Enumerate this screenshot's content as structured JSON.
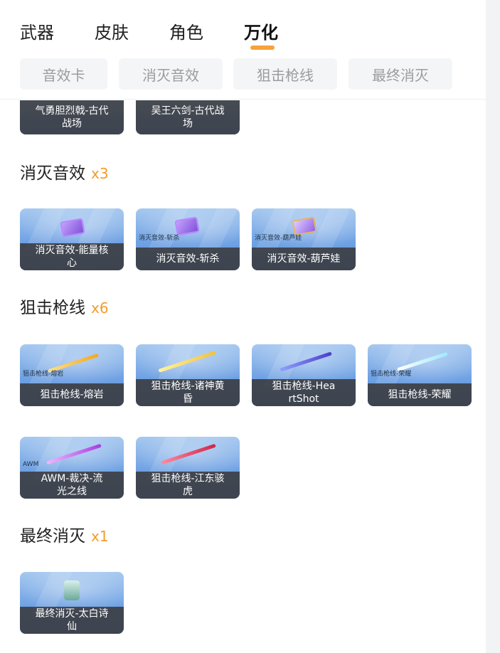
{
  "tabs": [
    "武器",
    "皮肤",
    "角色",
    "万化"
  ],
  "active_tab_index": 3,
  "filters": [
    "音效卡",
    "消灭音效",
    "狙击枪线",
    "最终消灭"
  ],
  "top_partial_cards": [
    {
      "line1": "气勇胆烈戟-古代",
      "line2": "战场"
    },
    {
      "line1": "吴王六剑-古代战",
      "line2": "场"
    }
  ],
  "sections": [
    {
      "title": "消灭音效",
      "count": "x3",
      "cards": [
        {
          "line1": "消灭音效-能量核",
          "line2": "心",
          "inner_label": "",
          "icon": "purple-card-icon"
        },
        {
          "line1": "消灭音效-斩杀",
          "line2": "",
          "inner_label": "消灭音效-斩杀",
          "icon": "purple-card-icon"
        },
        {
          "line1": "消灭音效-葫芦娃",
          "line2": "",
          "inner_label": "消灭音效-葫芦娃",
          "icon": "gold-card-icon"
        }
      ]
    },
    {
      "title": "狙击枪线",
      "count": "x6",
      "cards": [
        {
          "line1": "狙击枪线-熔岩",
          "line2": "",
          "inner_label": "狙击枪线-熔岩",
          "icon": "laser-icon",
          "color": "#f0c04a"
        },
        {
          "line1": "狙击枪线-诸神黄",
          "line2": "昏",
          "inner_label": "",
          "icon": "laser-icon",
          "color": "#f2c23c"
        },
        {
          "line1": "狙击枪线-Hea",
          "line2": "rtShot",
          "inner_label": "",
          "icon": "laser-icon",
          "color": "#5b4fd8"
        },
        {
          "line1": "狙击枪线-荣耀",
          "line2": "",
          "inner_label": "狙击枪线-荣耀",
          "icon": "laser-icon",
          "color": "#bff6ff"
        },
        {
          "line1": "AWM-裁决-流",
          "line2": "光之线",
          "inner_label": "AWM",
          "icon": "laser-icon",
          "color": "#c14ef0"
        },
        {
          "line1": "狙击枪线-江东骇",
          "line2": "虎",
          "inner_label": "",
          "icon": "laser-icon",
          "color": "#e2466a"
        }
      ]
    },
    {
      "title": "最终消灭",
      "count": "x1",
      "cards": [
        {
          "line1": "最终消灭-太白诗",
          "line2": "仙",
          "inner_label": "",
          "icon": "statue-icon"
        }
      ]
    }
  ],
  "colors": {
    "accent": "#f7a23a",
    "count": "#f39b2f",
    "card_caption_bg": "#3a3a3c",
    "card_bg": "#6fa1e3"
  }
}
